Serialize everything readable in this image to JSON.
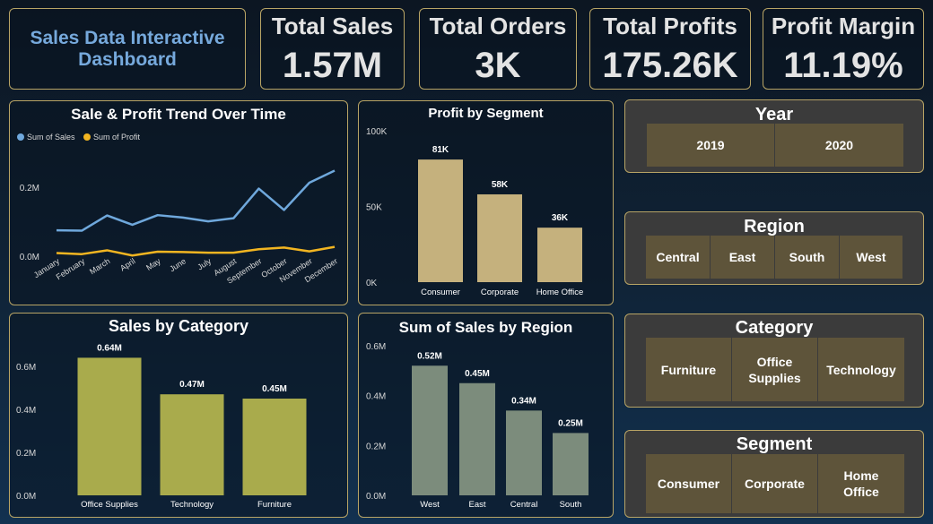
{
  "header": {
    "title": "Sales Data Interactive Dashboard"
  },
  "kpis": [
    {
      "label": "Total Sales",
      "value": "1.57M"
    },
    {
      "label": "Total Orders",
      "value": "3K"
    },
    {
      "label": "Total Profits",
      "value": "175.26K"
    },
    {
      "label": "Profit Margin",
      "value": "11.19%"
    }
  ],
  "colors": {
    "accent_border": "#b8a465",
    "sales_line": "#6fa8dc",
    "profit_line": "#f2b521",
    "segment_bar": "#c5b17d",
    "category_bar": "#a9ab4c",
    "region_bar": "#7c8c7c",
    "slicer_option": "#5e543a"
  },
  "slicers": {
    "year": {
      "title": "Year",
      "options": [
        "2019",
        "2020"
      ]
    },
    "region": {
      "title": "Region",
      "options": [
        "Central",
        "East",
        "South",
        "West"
      ]
    },
    "category": {
      "title": "Category",
      "options": [
        "Furniture",
        "Office Supplies",
        "Technology"
      ]
    },
    "segment": {
      "title": "Segment",
      "options": [
        "Consumer",
        "Corporate",
        "Home Office"
      ]
    }
  },
  "chart_data": [
    {
      "id": "trend",
      "type": "line",
      "title": "Sale & Profit Trend Over Time",
      "legend_position": "top-left",
      "x": [
        "January",
        "February",
        "March",
        "April",
        "May",
        "June",
        "July",
        "August",
        "September",
        "October",
        "November",
        "December"
      ],
      "yticks": [
        "0.0M",
        "0.2M"
      ],
      "ylim": [
        0,
        0.3
      ],
      "series": [
        {
          "name": "Sum of Sales",
          "values": [
            0.075,
            0.074,
            0.118,
            0.091,
            0.119,
            0.112,
            0.101,
            0.11,
            0.196,
            0.134,
            0.213,
            0.248
          ]
        },
        {
          "name": "Sum of Profit",
          "values": [
            0.009,
            0.006,
            0.017,
            0.002,
            0.013,
            0.012,
            0.01,
            0.01,
            0.02,
            0.025,
            0.014,
            0.027
          ]
        }
      ]
    },
    {
      "id": "segment",
      "type": "bar",
      "title": "Profit by Segment",
      "categories": [
        "Consumer",
        "Corporate",
        "Home Office"
      ],
      "values": [
        81,
        58,
        36
      ],
      "data_labels": [
        "81K",
        "58K",
        "36K"
      ],
      "yticks": [
        "0K",
        "50K",
        "100K"
      ],
      "ylim": [
        0,
        100
      ]
    },
    {
      "id": "category",
      "type": "bar",
      "title": "Sales by Category",
      "categories": [
        "Office Supplies",
        "Technology",
        "Furniture"
      ],
      "values": [
        0.64,
        0.47,
        0.45
      ],
      "data_labels": [
        "0.64M",
        "0.47M",
        "0.45M"
      ],
      "yticks": [
        "0.0M",
        "0.2M",
        "0.4M",
        "0.6M"
      ],
      "ylim": [
        0,
        0.6
      ]
    },
    {
      "id": "region",
      "type": "bar",
      "title": "Sum of Sales by Region",
      "categories": [
        "West",
        "East",
        "Central",
        "South"
      ],
      "values": [
        0.52,
        0.45,
        0.34,
        0.25
      ],
      "data_labels": [
        "0.52M",
        "0.45M",
        "0.34M",
        "0.25M"
      ],
      "yticks": [
        "0.0M",
        "0.2M",
        "0.4M",
        "0.6M"
      ],
      "ylim": [
        0,
        0.6
      ]
    }
  ]
}
